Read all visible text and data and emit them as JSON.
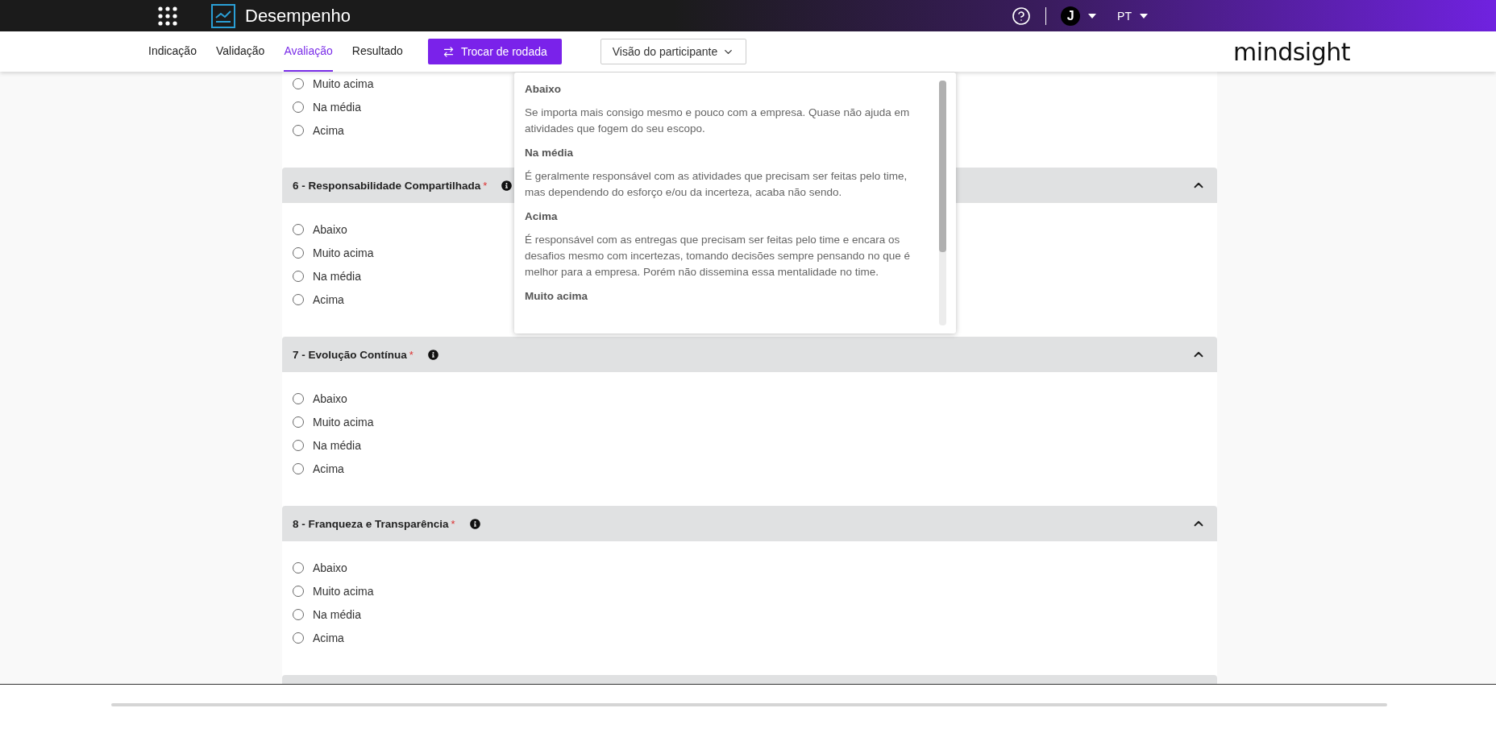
{
  "topbar": {
    "app_title": "Desempenho",
    "avatar_initial": "J",
    "language": "PT"
  },
  "nav": {
    "tabs": [
      {
        "label": "Indicação",
        "selected": false
      },
      {
        "label": "Validação",
        "selected": false
      },
      {
        "label": "Avaliação",
        "selected": true
      },
      {
        "label": "Resultado",
        "selected": false
      }
    ],
    "round_button": "Trocar de rodada",
    "view_dropdown": "Visão do participante",
    "brand": "mindsight"
  },
  "sections": [
    {
      "options": [
        {
          "label": "Muito acima",
          "selected": false
        },
        {
          "label": "Na média",
          "selected": false
        },
        {
          "label": "Acima",
          "selected": false
        }
      ]
    },
    {
      "title": "6 - Responsabilidade Compartilhada",
      "required_mark": "*",
      "expanded": true,
      "options": [
        {
          "label": "Abaixo",
          "selected": false
        },
        {
          "label": "Muito acima",
          "selected": false
        },
        {
          "label": "Na média",
          "selected": false
        },
        {
          "label": "Acima",
          "selected": false
        }
      ]
    },
    {
      "title": "7 - Evolução Contínua",
      "required_mark": "*",
      "expanded": true,
      "options": [
        {
          "label": "Abaixo",
          "selected": false
        },
        {
          "label": "Muito acima",
          "selected": false
        },
        {
          "label": "Na média",
          "selected": false
        },
        {
          "label": "Acima",
          "selected": false
        }
      ]
    },
    {
      "title": "8 - Franqueza e Transparência",
      "required_mark": "*",
      "expanded": true,
      "options": [
        {
          "label": "Abaixo",
          "selected": false
        },
        {
          "label": "Muito acima",
          "selected": false
        },
        {
          "label": "Na média",
          "selected": false
        },
        {
          "label": "Acima",
          "selected": false
        }
      ]
    }
  ],
  "tooltip": {
    "items": [
      {
        "title": "Abaixo",
        "description": "Se importa mais consigo mesmo e pouco com a empresa. Quase não ajuda em atividades que fogem do seu escopo."
      },
      {
        "title": "Na média",
        "description": "É geralmente responsável com as atividades que precisam ser feitas pelo time, mas dependendo do esforço e/ou da incerteza, acaba não sendo."
      },
      {
        "title": "Acima",
        "description": "É responsável com as entregas que precisam ser feitas pelo time e encara os desafios mesmo com incertezas, tomando decisões sempre pensando no que é melhor para a empresa. Porém não dissemina essa mentalidade no time."
      },
      {
        "title": "Muito acima"
      }
    ]
  }
}
